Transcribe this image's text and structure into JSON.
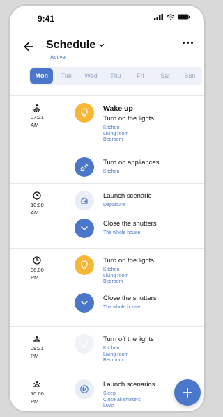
{
  "status_bar": {
    "time": "9:41"
  },
  "header": {
    "title": "Schedule",
    "subtitle": "Active"
  },
  "days": [
    "Mon",
    "Tue",
    "Wed",
    "Thu",
    "Fri",
    "Sat",
    "Sun"
  ],
  "selected_day": "Mon",
  "groups": [
    {
      "icon": "sunrise-icon",
      "time_lines": [
        "07:21",
        "AM"
      ],
      "items": [
        {
          "icon": "lightbulb-icon",
          "style": "yellow",
          "title": "Wake up",
          "subtitle": "Turn on the lights",
          "lines": [
            "Kitchen",
            "Living room",
            "Bedroom"
          ]
        },
        {
          "icon": "plug-icon",
          "style": "blue",
          "title": "Turn on appliances",
          "lines": [
            "Kitchen"
          ]
        }
      ]
    },
    {
      "icon": "clock-icon",
      "time_lines": [
        "10:00",
        "AM"
      ],
      "items": [
        {
          "icon": "scenario-icon",
          "style": "light",
          "title": "Launch scenario",
          "lines": [
            "Departure"
          ]
        },
        {
          "icon": "chevron-down-icon",
          "style": "blue",
          "title": "Close the shutters",
          "lines": [
            "The whole house"
          ]
        }
      ]
    },
    {
      "icon": "clock-icon",
      "time_lines": [
        "06:00",
        "PM"
      ],
      "items": [
        {
          "icon": "lightbulb-icon",
          "style": "yellow",
          "title": "Turn on the lights",
          "lines": [
            "Kitchen",
            "Living room",
            "Bedroom"
          ]
        },
        {
          "icon": "chevron-down-icon",
          "style": "blue",
          "title": "Close the shutters",
          "lines": [
            "The whole house"
          ]
        }
      ]
    },
    {
      "icon": "sunset-icon",
      "time_lines": [
        "09:21",
        "PM"
      ],
      "items": [
        {
          "icon": "lightbulb-off-icon",
          "style": "faded",
          "title": "Turn off the lights",
          "lines": [
            "Kitchen",
            "Living room",
            "Bedroom"
          ]
        }
      ]
    },
    {
      "icon": "sunset-icon",
      "time_lines": [
        "10:00",
        "PM"
      ],
      "items": [
        {
          "icon": "play-scenario-icon",
          "style": "outline",
          "title": "Launch scenarios",
          "lines": [
            "Sleep",
            "Close all shutters",
            "Love"
          ]
        }
      ]
    }
  ],
  "colors": {
    "accent": "#4a77c9",
    "yellow": "#f7b633",
    "text": "#111111"
  }
}
